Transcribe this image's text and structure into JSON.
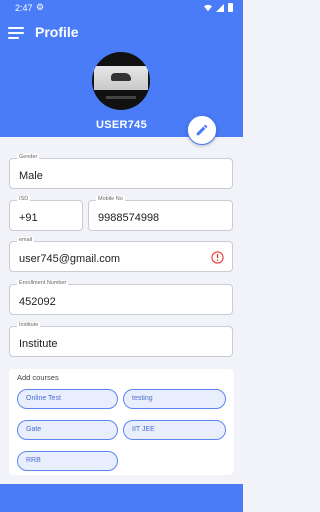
{
  "status_bar": {
    "time": "2:47"
  },
  "header": {
    "title": "Profile",
    "username": "USER745"
  },
  "fields": {
    "gender": {
      "label": "Gender",
      "value": "Male"
    },
    "isd": {
      "label": "ISD",
      "value": "+91"
    },
    "mobile": {
      "label": "Mobile No",
      "value": "9988574998"
    },
    "email": {
      "label": "email",
      "value": "user745@gmail.com"
    },
    "enrollment": {
      "label": "Enrollment Number",
      "value": "452092"
    },
    "institute": {
      "label": "Institute",
      "value": "Institute"
    }
  },
  "courses": {
    "label": "Add courses",
    "items": [
      "Online Test",
      "testing",
      "Gate",
      "IIT JEE",
      "RRB"
    ]
  },
  "colors": {
    "primary": "#4a7cf7",
    "error": "#e53935"
  }
}
